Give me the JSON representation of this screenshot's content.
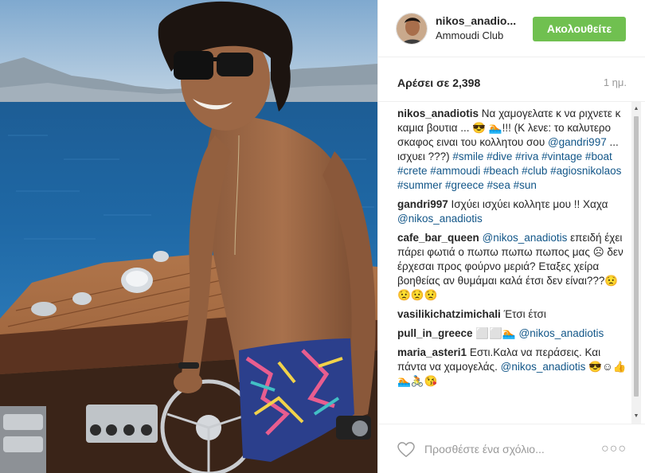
{
  "post": {
    "username": "nikos_anadio...",
    "location": "Ammoudi Club",
    "follow_label": "Ακολουθείτε",
    "likes": "Αρέσει σε 2,398",
    "time": "1 ημ."
  },
  "comments": [
    {
      "user": "nikos_anadiotis",
      "parts": [
        {
          "t": " Να χαμογελατε κ να ριχνετε κ καμια βουτια ... 😎 🏊!!! (Κ λενε: το καλυτερο σκαφος ειναι του κολλητου σου "
        },
        {
          "t": "@gandri997",
          "link": true
        },
        {
          "t": " ... ισχυει ???) "
        },
        {
          "t": "#smile #dive #riva #vintage #boat #crete #ammoudi #beach #club #agiosnikolaos #summer #greece #sea #sun",
          "link": true
        }
      ]
    },
    {
      "user": "gandri997",
      "parts": [
        {
          "t": " Ισχύει ισχύει κολλητε μου !! Χαχα "
        },
        {
          "t": "@nikos_anadiotis",
          "link": true
        }
      ]
    },
    {
      "user": "cafe_bar_queen",
      "parts": [
        {
          "t": " "
        },
        {
          "t": "@nikos_anadiotis",
          "link": true
        },
        {
          "t": " επειδή έχει πάρει φωτιά ο πωπω πωπω πωπος μας ☹ δεν έρχεσαι προς φούρνο μεριά? Εταξες χείρα βοηθείας αν θυμάμαι καλά έτσι δεν είναι???😟😟😟😟"
        }
      ]
    },
    {
      "user": "vasilikichatzimichali",
      "parts": [
        {
          "t": " Έτσι έτσι"
        }
      ]
    },
    {
      "user": "pull_in_greece",
      "parts": [
        {
          "t": " ⬜⬜🏊 "
        },
        {
          "t": "@nikos_anadiotis",
          "link": true
        }
      ]
    },
    {
      "user": "maria_asteri1",
      "parts": [
        {
          "t": " Εστι.Καλα να περάσεις. Και πάντα να χαμογελάς. "
        },
        {
          "t": "@nikos_anadiotis",
          "link": true
        },
        {
          "t": " 😎☺👍🏊🚴😘"
        }
      ]
    }
  ],
  "add_comment": {
    "placeholder": "Προσθέστε ένα σχόλιο..."
  },
  "icons": {
    "like": "heart-icon",
    "more": "more-options-icon"
  },
  "colors": {
    "follow": "#70c050",
    "link": "#125688"
  }
}
